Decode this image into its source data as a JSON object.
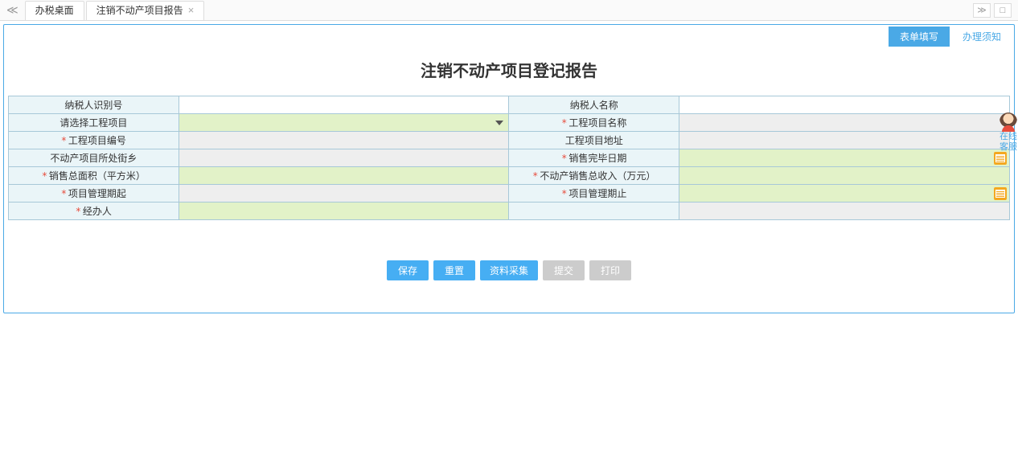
{
  "tabs": {
    "tab1": "办税桌面",
    "tab2": "注销不动产项目报告"
  },
  "toolbar": {
    "fill": "表单填写",
    "notice": "办理须知"
  },
  "title": "注销不动产项目登记报告",
  "labels": {
    "taxpayerId": "纳税人识别号",
    "taxpayerName": "纳税人名称",
    "selectProject": "请选择工程项目",
    "projectName": "工程项目名称",
    "projectNo": "工程项目编号",
    "projectAddr": "工程项目地址",
    "township": "不动产项目所处街乡",
    "saleDone": "销售完毕日期",
    "saleArea": "销售总面积（平方米）",
    "saleRevenue": "不动产销售总收入（万元）",
    "mgmtStart": "项目管理期起",
    "mgmtEnd": "项目管理期止",
    "handler": "经办人"
  },
  "values": {
    "taxpayerId": "",
    "taxpayerName": "",
    "projectSelect": "",
    "projectName": "",
    "projectNo": "",
    "projectAddr": "",
    "township": "",
    "saleDone": "",
    "saleArea": "",
    "saleRevenue": "",
    "mgmtStart": "",
    "mgmtEnd": "",
    "handler": ""
  },
  "buttons": {
    "save": "保存",
    "reset": "重置",
    "collect": "资料采集",
    "submit": "提交",
    "print": "打印"
  },
  "side": {
    "label": "在线客服"
  }
}
